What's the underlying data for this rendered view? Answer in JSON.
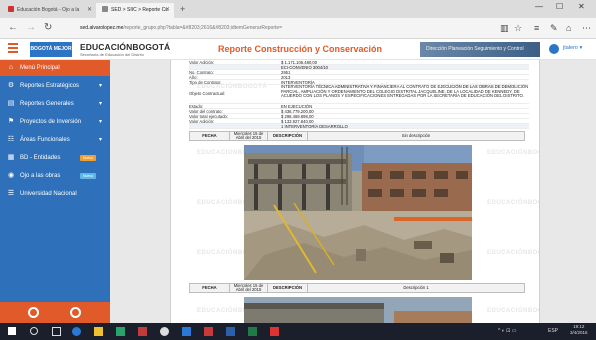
{
  "browser": {
    "tabs": [
      {
        "label": "Educación Bogotá - Ojo a la"
      },
      {
        "label": "SED > SIIC > Reporte Cc"
      }
    ],
    "url_host": "sed.alvarolopez.me",
    "url_path": "/reporte_grupo.php?tabla=&#8203;2616&#8203;idtemGenerarReporte="
  },
  "header": {
    "logo_text": "BOGOTÁ MEJOR",
    "brand": "EDUCACIÓNBOGOTÁ",
    "brand_sub": "Secretaría de Educación del Distrito",
    "page_title": "Reporte Construcción y Conservación",
    "banner_text": "Dirección Planeación Seguimiento y Control",
    "user_name": "jtalero ▾"
  },
  "sidebar": {
    "items": [
      {
        "label": "Menú Principal",
        "icon": "home-icon"
      },
      {
        "label": "Reportes Estratégicos",
        "icon": "cogs-icon"
      },
      {
        "label": "Reportes Generales",
        "icon": "document-icon"
      },
      {
        "label": "Proyectos de Inversión",
        "icon": "flag-icon"
      },
      {
        "label": "Áreas Funcionales",
        "icon": "users-icon"
      },
      {
        "label": "BD - Entidades",
        "icon": "database-icon",
        "badge": "Nuevo"
      },
      {
        "label": "Ojo a las obras",
        "icon": "eye-icon",
        "badge": "Nuevo"
      },
      {
        "label": "Universidad Nacional",
        "icon": "list-icon"
      }
    ]
  },
  "report": {
    "watermark": "EDUCACIÓNBOGOTÁ",
    "fields": [
      {
        "k": "Valor Adición:",
        "v": "$ 1.171.106.480,00"
      },
      {
        "k": "",
        "v": "ECI-CONVENIO 3004/10"
      },
      {
        "k": "No. Contrato:",
        "v": "2951"
      },
      {
        "k": "Año:",
        "v": "2013"
      },
      {
        "k": "Tipo de Contrato:",
        "v": "INTERVENTORÍA"
      },
      {
        "k": "Objeto Contractual:",
        "v": "INTERVENTORÍA TÉCNICA ADMINISTRATIVA Y FINANCIERA AL CONTRATO DE EJECUCIÓN DE LAS OBRAS DE DEMOLICIÓN PARCIAL, AMPLIACIÓN Y ORDENAMIENTO DEL COLEGIO DISTRITAL JACQUELINE, DE LA LOCALIDAD DE KENNEDY, DE ACUERDO CON LOS PLANOS Y ESPECIFICACIONES ENTREGADAS POR LA SECRETARÍA DE EDUCACIÓN DEL DISTRITO."
      },
      {
        "k": "Estado:",
        "v": "EN EJECUCIÓN"
      },
      {
        "k": "Valor del contrato:",
        "v": "$ 436.779.200,00"
      },
      {
        "k": "Valor total ejecutado:",
        "v": "$ 298.469.898,00"
      },
      {
        "k": "Valor Adición:",
        "v": "$ 133.927.840,00"
      },
      {
        "k": "",
        "v": "1 INTERVENTORÍA DESARROLLO"
      }
    ],
    "photos": [
      {
        "label": "FECHA",
        "date": "Miercoles 15 de Abril del 2015",
        "desc_label": "DESCRIPCIÓN",
        "desc": "Sin descripción"
      },
      {
        "label": "FECHA",
        "date": "Miercoles 15 de Abril del 2015",
        "desc_label": "DESCRIPCIÓN",
        "desc": "Descripción 1"
      }
    ]
  },
  "taskbar": {
    "language": "ESP",
    "time": "19:12",
    "date": "3/4/2016"
  }
}
